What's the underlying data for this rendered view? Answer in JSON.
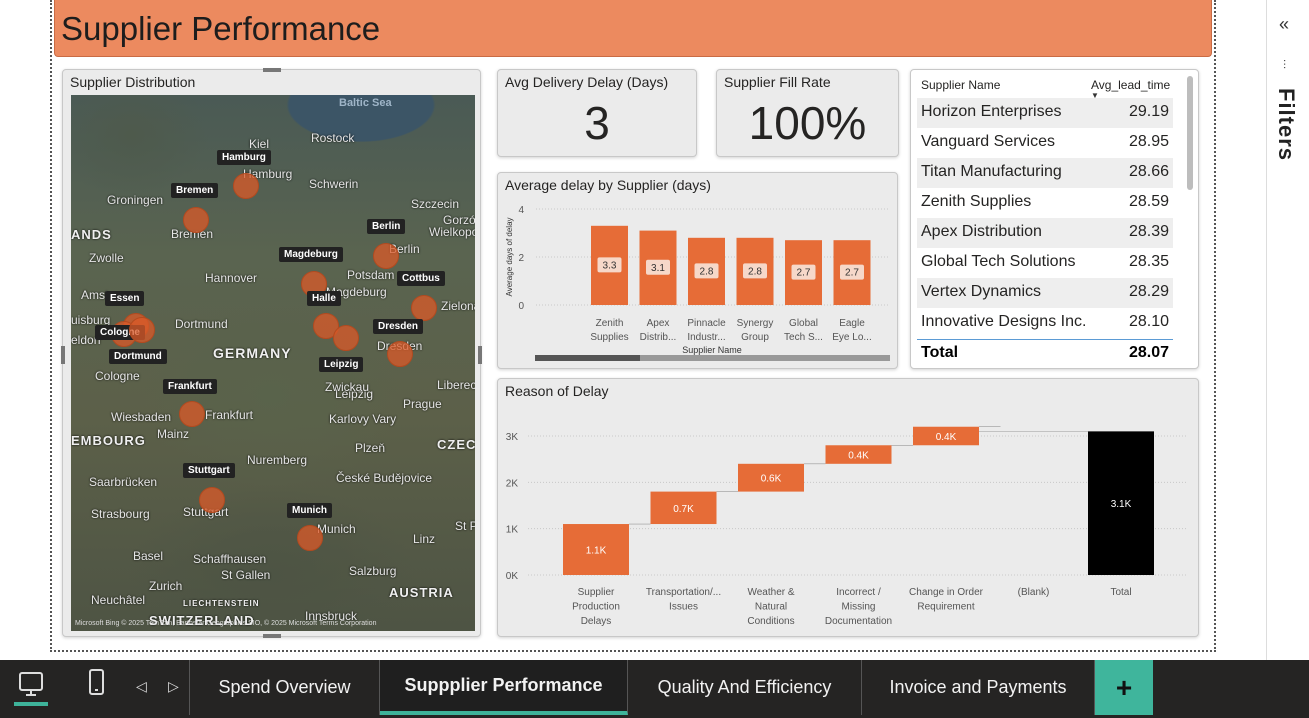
{
  "report": {
    "title": "Supplier Performance"
  },
  "map": {
    "title": "Supplier Distribution",
    "sea": "Baltic Sea",
    "country": "GERMANY",
    "edge_labels": [
      "ANDS",
      "EMBOURG",
      "CZEC",
      "AUSTRIA",
      "SWITZERLAND",
      "LIECHTENSTEIN"
    ],
    "places": [
      "Kiel",
      "Rostock",
      "Hamburg",
      "Schwerin",
      "Groningen",
      "Bremen",
      "Szczecin",
      "Gorzó",
      "Wielkopo",
      "Zwolle",
      "Hannover",
      "Potsdam",
      "Berlin",
      "Magdeburg",
      "Amst",
      "Dortmund",
      "Zielona",
      "uisburg",
      "eldorf",
      "Dresden",
      "Cologne",
      "Leipzig",
      "Zwickau",
      "Liberec",
      "Wiesbaden",
      "Frankfurt",
      "Mainz",
      "Prague",
      "Karlovy Vary",
      "Plzeň",
      "Nuremberg",
      "Saarbrücken",
      "České Budějovice",
      "Strasbourg",
      "Stuttgart",
      "Linz",
      "St P",
      "Munich",
      "Basel",
      "Schaffhausen",
      "Zurich",
      "St Gallen",
      "Salzburg",
      "Neuchâtel",
      "Innsbruck"
    ],
    "markers": [
      "Hamburg",
      "Bremen",
      "Berlin",
      "Magdeburg",
      "Cottbus",
      "Essen",
      "Halle",
      "Cologne",
      "Dresden",
      "Dortmund",
      "Leipzig",
      "Frankfurt",
      "Stuttgart",
      "Munich"
    ],
    "credit": "Microsoft Bing  © 2025 TomTom, Earthstar Geographics SIO, © 2025 Microsoft  Terms",
    "credit_extra": "Corporation"
  },
  "kpis": {
    "delay": {
      "label": "Avg Delivery Delay (Days)",
      "value": "3"
    },
    "fill": {
      "label": "Supplier Fill Rate",
      "value": "100%"
    }
  },
  "table": {
    "columns": [
      "Supplier Name",
      "Avg_lead_time"
    ],
    "rows": [
      {
        "name": "Horizon Enterprises",
        "value": "29.19"
      },
      {
        "name": "Vanguard Services",
        "value": "28.95"
      },
      {
        "name": "Titan Manufacturing",
        "value": "28.66"
      },
      {
        "name": "Zenith Supplies",
        "value": "28.59"
      },
      {
        "name": "Apex Distribution",
        "value": "28.39"
      },
      {
        "name": "Global Tech Solutions",
        "value": "28.35"
      },
      {
        "name": "Vertex Dynamics",
        "value": "28.29"
      },
      {
        "name": "Innovative Designs Inc.",
        "value": "28.10"
      }
    ],
    "total_label": "Total",
    "total_value": "28.07"
  },
  "chart_data": [
    {
      "type": "bar",
      "title": "Average delay by Supplier (days)",
      "xlabel": "Supplier Name",
      "ylabel": "Average days of delay",
      "ylim": [
        0,
        4
      ],
      "yticks": [
        "0",
        "2",
        "4"
      ],
      "categories": [
        [
          "Zenith",
          "Supplies"
        ],
        [
          "Apex",
          "Distrib..."
        ],
        [
          "Pinnacle",
          "Industr..."
        ],
        [
          "Synergy",
          "Group"
        ],
        [
          "Global",
          "Tech S..."
        ],
        [
          "Eagle",
          "Eye Lo..."
        ]
      ],
      "values": [
        3.3,
        3.1,
        2.8,
        2.8,
        2.7,
        2.7
      ],
      "value_labels": [
        "3.3",
        "3.1",
        "2.8",
        "2.8",
        "2.7",
        "2.7"
      ],
      "color": "#e66c37",
      "grid": true
    },
    {
      "type": "bar",
      "subtype": "waterfall",
      "title": "Reason of Delay",
      "ylim": [
        0,
        3000
      ],
      "yticks": [
        "0K",
        "1K",
        "2K",
        "3K"
      ],
      "categories": [
        [
          "Supplier",
          "Production",
          "Delays"
        ],
        [
          "Transportation/...",
          "Issues"
        ],
        [
          "Weather &",
          "Natural",
          "Conditions"
        ],
        [
          "Incorrect /",
          "Missing",
          "Documentation"
        ],
        [
          "Change in Order",
          "Requirement"
        ],
        [
          "(Blank)"
        ],
        [
          "Total"
        ]
      ],
      "values": [
        1100,
        700,
        600,
        400,
        400,
        0,
        3100
      ],
      "value_labels": [
        "1.1K",
        "0.7K",
        "0.6K",
        "0.4K",
        "0.4K",
        "",
        "3.1K"
      ],
      "colors": {
        "increase": "#e66c37",
        "total": "#000000"
      },
      "grid": true
    }
  ],
  "filters": {
    "label": "Filters",
    "collapse_icon": "double-chevron-left-icon",
    "icon": "filter-icon"
  },
  "tabs": [
    {
      "label": "Spend Overview"
    },
    {
      "label": "Suppplier Performance"
    },
    {
      "label": "Quality And Efficiency"
    },
    {
      "label": "Invoice and Payments"
    }
  ],
  "add_page_label": "+",
  "colors": {
    "title_bar": "#ec8a5f",
    "accent": "#3eb39a",
    "bar": "#e66c37"
  }
}
